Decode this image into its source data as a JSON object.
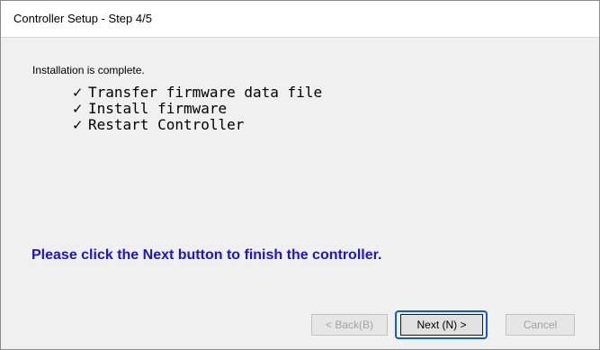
{
  "window": {
    "title": "Controller Setup - Step 4/5"
  },
  "content": {
    "status": "Installation is complete.",
    "steps": [
      {
        "check": "✓",
        "label": "Transfer firmware data file"
      },
      {
        "check": "✓",
        "label": "Install firmware"
      },
      {
        "check": "✓",
        "label": "Restart Controller"
      }
    ],
    "instruction": "Please click the Next button to finish the controller.",
    "instruction_color": "#1a14d8"
  },
  "buttons": {
    "back": {
      "label": "< Back(B)",
      "enabled": false
    },
    "next": {
      "label": "Next (N) >",
      "enabled": true,
      "focused": true
    },
    "cancel": {
      "label": "Cancel",
      "enabled": false
    }
  },
  "colors": {
    "focus_ring": "#0a5fd1",
    "disabled_text": "#a3a3a3"
  }
}
